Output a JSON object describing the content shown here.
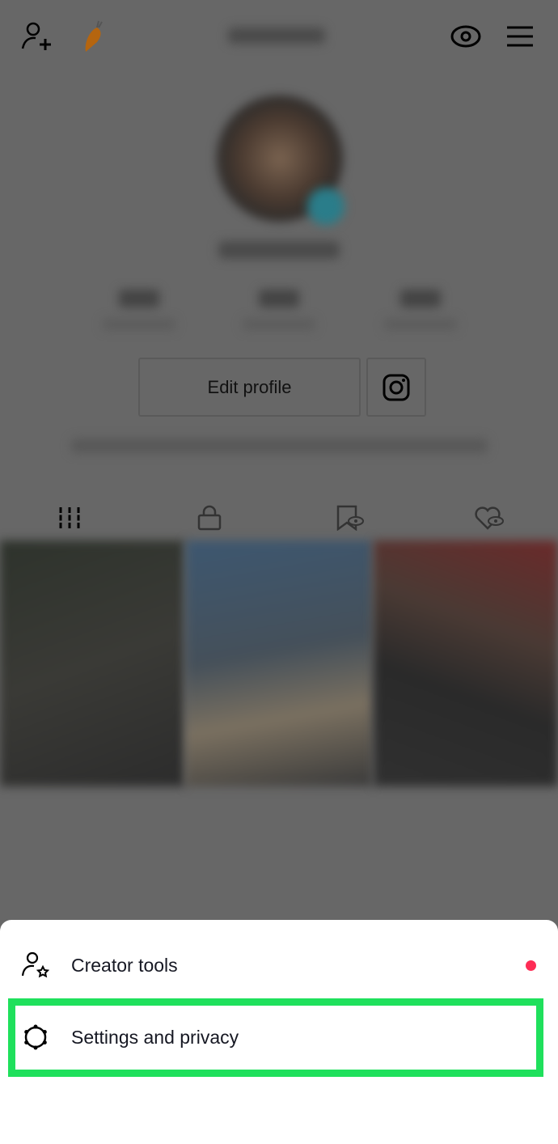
{
  "header": {
    "add_friend_icon": "person-plus",
    "carrot_icon": "carrot",
    "views_icon": "eye",
    "menu_icon": "hamburger"
  },
  "profile": {
    "edit_profile_label": "Edit profile",
    "instagram_icon": "instagram"
  },
  "tabs": [
    {
      "icon": "grid"
    },
    {
      "icon": "lock"
    },
    {
      "icon": "bookmark-hidden"
    },
    {
      "icon": "heart-hidden"
    }
  ],
  "sheet": {
    "items": [
      {
        "label": "Creator tools",
        "icon": "person-star",
        "badge_color": "#fe2c55"
      },
      {
        "label": "Settings and privacy",
        "icon": "gear",
        "highlighted": true
      }
    ],
    "highlight_color": "#1fe05c"
  }
}
